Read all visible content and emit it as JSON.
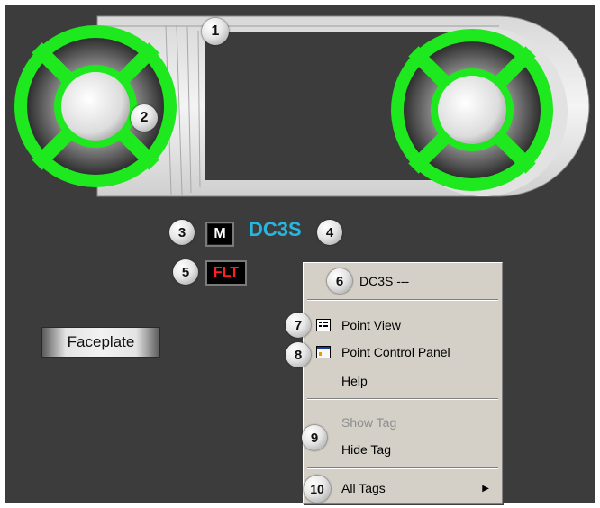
{
  "colors": {
    "background": "#3c3c3c",
    "drum_ring": "#1ee81e",
    "tag": "#27b6df",
    "fault": "#ff2020"
  },
  "callouts": [
    "1",
    "2",
    "3",
    "4",
    "5",
    "6",
    "7",
    "8",
    "9",
    "10"
  ],
  "motor": {
    "mode_label": "M",
    "tag_name": "DC3S",
    "fault_label": "FLT"
  },
  "faceplate_label": "Faceplate",
  "context_menu": {
    "header": "DC3S ---",
    "items": [
      {
        "label": "Point View",
        "icon": "point-view-icon",
        "enabled": true
      },
      {
        "label": "Point Control Panel",
        "icon": "control-panel-icon",
        "enabled": true
      },
      {
        "label": "Help",
        "enabled": true
      },
      {
        "label": "Show Tag",
        "enabled": false
      },
      {
        "label": "Hide Tag",
        "enabled": true
      },
      {
        "label": "All Tags",
        "submenu": true,
        "enabled": true
      }
    ]
  }
}
